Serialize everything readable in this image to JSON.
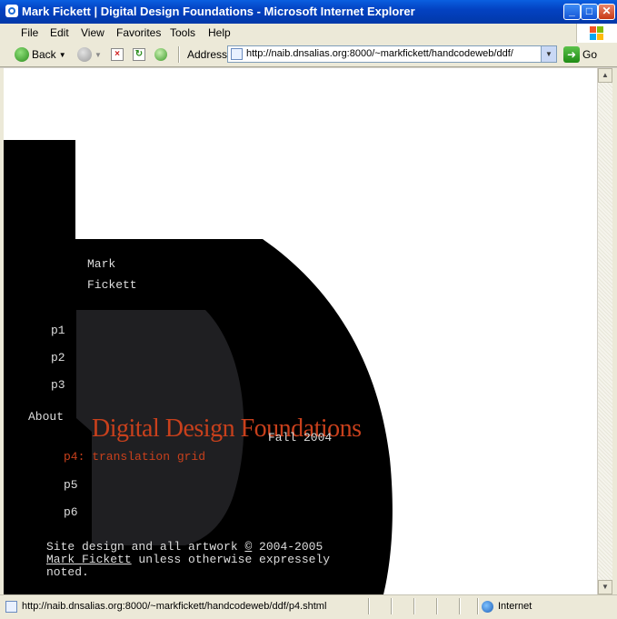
{
  "window": {
    "title": "Mark Fickett | Digital Design Foundations - Microsoft Internet Explorer",
    "minimize": "_",
    "maximize": "□",
    "close": "✕"
  },
  "menu": {
    "items": [
      {
        "label": "File"
      },
      {
        "label": "Edit"
      },
      {
        "label": "View"
      },
      {
        "label": "Favorites"
      },
      {
        "label": "Tools"
      },
      {
        "label": "Help"
      }
    ]
  },
  "toolbar": {
    "back_label": "Back",
    "address_label": "Address",
    "address_value": "http://naib.dnsalias.org:8000/~markfickett/handcodeweb/ddf/",
    "go_label": "Go"
  },
  "page": {
    "author_first": "Mark",
    "author_last": "Fickett",
    "nav": [
      {
        "label": "p1"
      },
      {
        "label": "p2"
      },
      {
        "label": "p3"
      },
      {
        "label": "About"
      },
      {
        "label": "p4: translation grid"
      },
      {
        "label": "p5"
      },
      {
        "label": "p6"
      }
    ],
    "course_title": "Digital Design Foundations",
    "term": "Fall 2004",
    "copyright_line1": "Site design and all artwork ",
    "copyright_symbol": "©",
    "copyright_years": " 2004-2005",
    "copyright_link": "Mark Fickett",
    "copyright_line2_rest": " unless otherwise expressely",
    "copyright_line3": "noted.",
    "colors": {
      "background": "#000000",
      "inner_shape": "#1f1f22",
      "accent": "#c8401c",
      "text": "#dddddd"
    }
  },
  "status": {
    "url": "http://naib.dnsalias.org:8000/~markfickett/handcodeweb/ddf/p4.shtml",
    "zone": "Internet"
  }
}
